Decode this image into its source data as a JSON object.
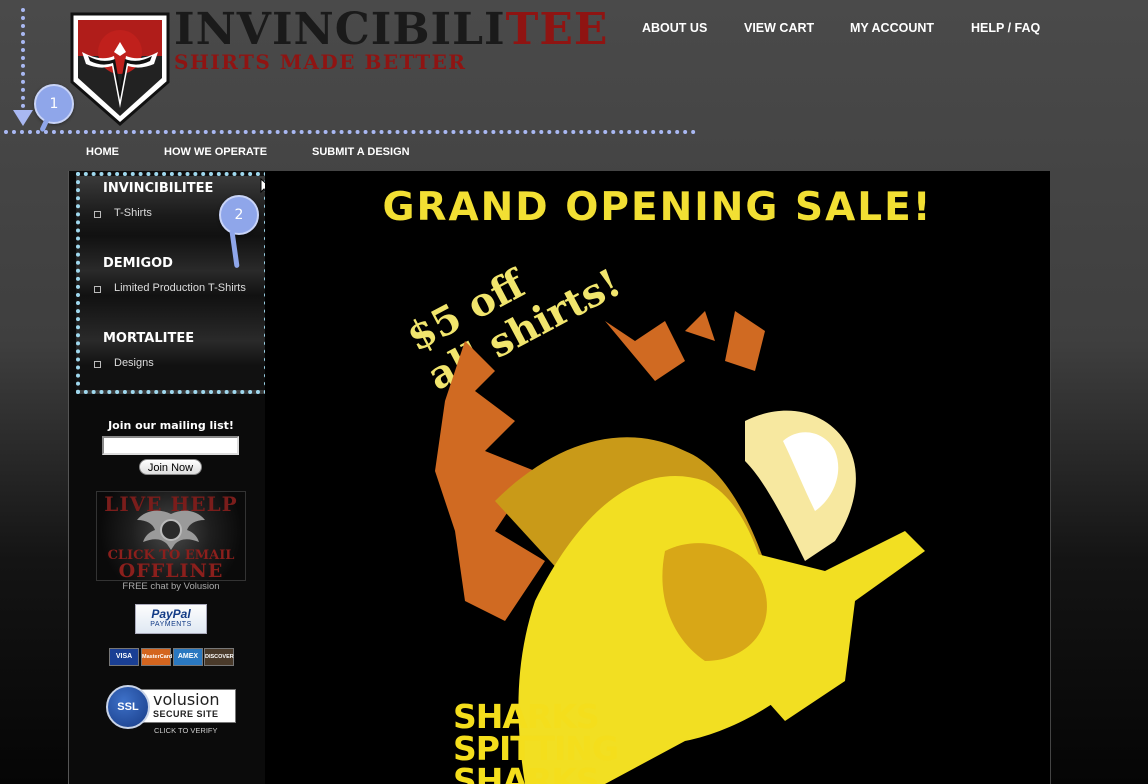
{
  "brand": {
    "name_dark": "INVINCIBILI",
    "name_red": "TEE",
    "tagline": "SHIRTS MADE BETTER"
  },
  "top_nav": [
    {
      "label": "ABOUT US"
    },
    {
      "label": "VIEW CART"
    },
    {
      "label": "MY ACCOUNT"
    },
    {
      "label": "HELP / FAQ"
    }
  ],
  "sub_nav": [
    {
      "label": "HOME"
    },
    {
      "label": "HOW WE OPERATE"
    },
    {
      "label": "SUBMIT A DESIGN"
    }
  ],
  "annotations": {
    "pin1": "1",
    "pin2": "2"
  },
  "categories": [
    {
      "heading": "INVINCIBILITEE",
      "link": "T-Shirts"
    },
    {
      "heading": "DEMIGOD",
      "link": "Limited Production T-Shirts"
    },
    {
      "heading": "MORTALITEE",
      "link": "Designs"
    }
  ],
  "mailing": {
    "label": "Join our mailing list!",
    "input_value": "",
    "button": "Join Now"
  },
  "live_help": {
    "top": "LIVE HELP",
    "mid": "CLICK TO EMAIL",
    "bot": "OFFLINE",
    "credit": "FREE chat by Volusion"
  },
  "paypal": {
    "line1": "PayPal",
    "line2": "PAYMENTS"
  },
  "cards": [
    {
      "label": "VISA",
      "color": "#1a3f94"
    },
    {
      "label": "MasterCard",
      "color": "#d4651f"
    },
    {
      "label": "AMEX",
      "color": "#2a78c0"
    },
    {
      "label": "DISCOVER",
      "color": "#4a3a2a"
    }
  ],
  "ssl": {
    "badge": "SSL",
    "brand": "volusion",
    "sub": "SECURE SITE",
    "verify": "CLICK TO VERIFY"
  },
  "banner": {
    "headline": "GRAND OPENING SALE!",
    "promo_line1": "$5 off",
    "promo_line2": "all shirts!",
    "shirt_text": [
      "SHARKS",
      "SPITTING",
      "SHARKS"
    ]
  }
}
